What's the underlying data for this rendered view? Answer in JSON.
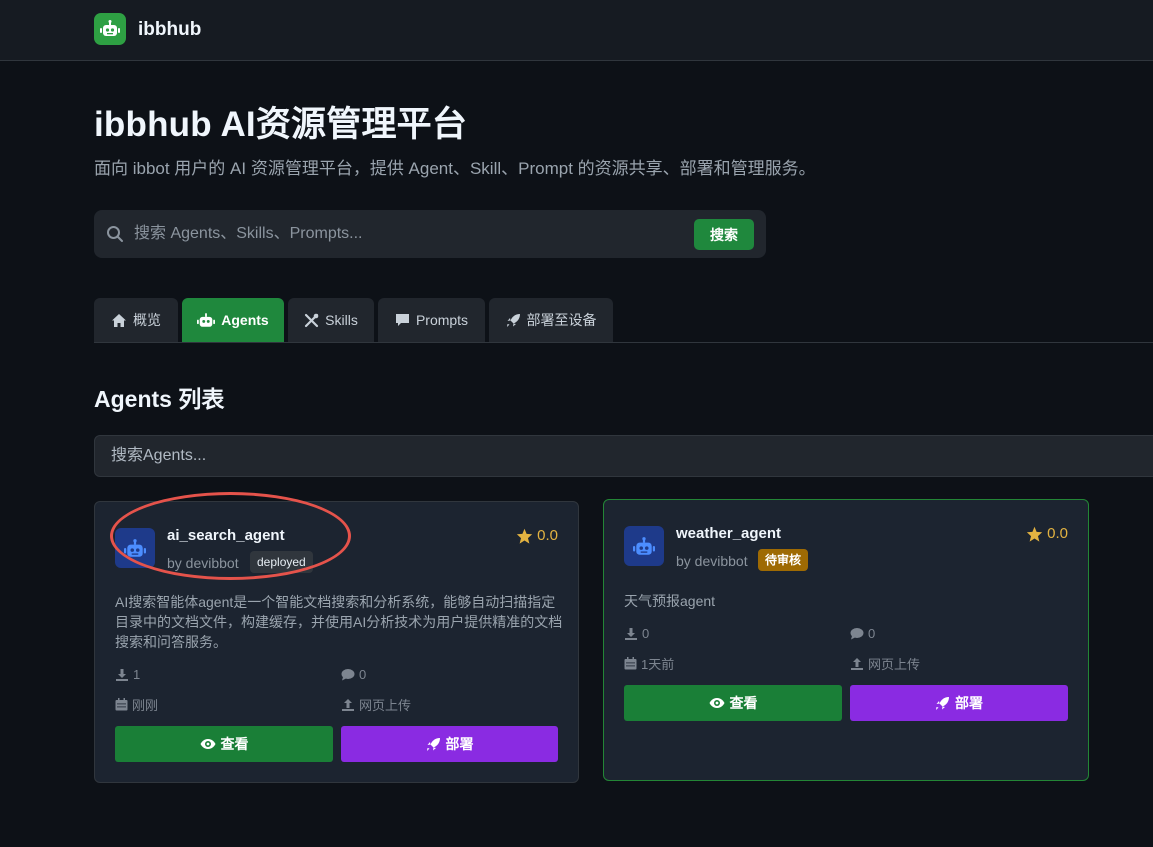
{
  "brand": {
    "name": "ibbhub",
    "logo_icon": "robot-icon"
  },
  "hero": {
    "title": "ibbhub AI资源管理平台",
    "subtitle": "面向 ibbot 用户的 AI 资源管理平台，提供 Agent、Skill、Prompt 的资源共享、部署和管理服务。"
  },
  "search": {
    "placeholder": "搜索 Agents、Skills、Prompts...",
    "button_label": "搜索"
  },
  "tabs": [
    {
      "label": "概览",
      "icon": "home-icon",
      "active": false
    },
    {
      "label": "Agents",
      "icon": "robot-icon",
      "active": true
    },
    {
      "label": "Skills",
      "icon": "tools-icon",
      "active": false
    },
    {
      "label": "Prompts",
      "icon": "comment-icon",
      "active": false
    },
    {
      "label": "部署至设备",
      "icon": "rocket-icon",
      "active": false
    }
  ],
  "section": {
    "title": "Agents 列表",
    "filter_placeholder": "搜索Agents..."
  },
  "colors": {
    "accent": "#1f883d",
    "deploy": "#8a2be2",
    "rating": "#e3b341",
    "highlight": "#e5534b"
  },
  "agents": [
    {
      "name": "ai_search_agent",
      "author": "by devibbot",
      "status": "deployed",
      "rating": "0.0",
      "description": "AI搜索智能体agent是一个智能文档搜索和分析系统，能够自动扫描指定目录中的文档文件，构建缓存，并使用AI分析技术为用户提供精准的文档搜索和问答服务。",
      "downloads": "1",
      "comments": "0",
      "time": "刚刚",
      "source": "网页上传",
      "view_label": "查看",
      "deploy_label": "部署"
    },
    {
      "name": "weather_agent",
      "author": "by devibbot",
      "status": "待审核",
      "rating": "0.0",
      "description": "天气预报agent",
      "downloads": "0",
      "comments": "0",
      "time": "1天前",
      "source": "网页上传",
      "view_label": "查看",
      "deploy_label": "部署"
    }
  ]
}
